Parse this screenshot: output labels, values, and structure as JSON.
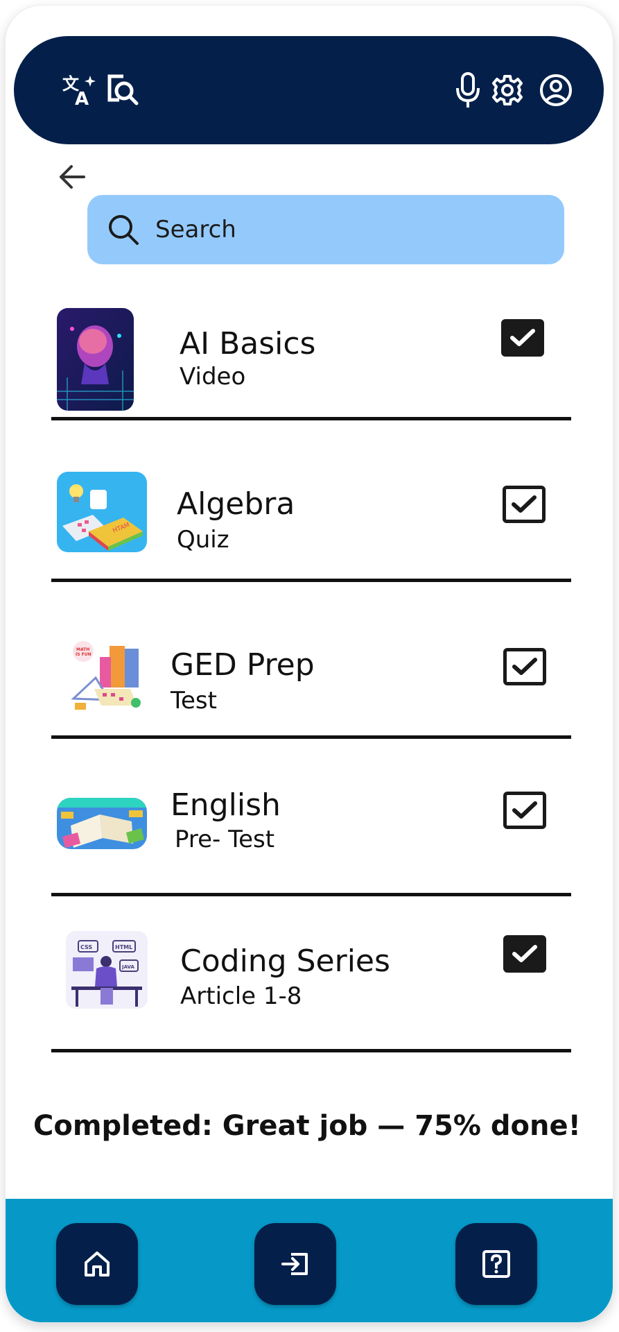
{
  "search": {
    "placeholder": "Search"
  },
  "items": [
    {
      "title": "AI Basics",
      "type": "Video",
      "checked": "filled"
    },
    {
      "title": "Algebra",
      "type": "Quiz",
      "checked": "outline"
    },
    {
      "title": "GED Prep",
      "type": "Test",
      "checked": "outline"
    },
    {
      "title": "English",
      "type": "Pre- Test",
      "checked": "outline"
    },
    {
      "title": "Coding Series",
      "type": "Article 1-8",
      "checked": "filled"
    }
  ],
  "status": {
    "completed_text": "Completed: Great job — 75% done!"
  },
  "thumb_labels": {
    "algebra_book": "HTAM",
    "ged_sign_1": "MATH",
    "ged_sign_2": "IS FUN",
    "coding_css": "CSS",
    "coding_html": "HTML",
    "coding_java": "JAVA"
  },
  "icons": {
    "translate": "translate-icon",
    "search_doc": "document-search-icon",
    "mic": "microphone-icon",
    "settings": "gear-icon",
    "profile": "account-circle-icon",
    "back": "arrow-left-icon",
    "search": "search-icon",
    "home": "home-icon",
    "login": "login-icon",
    "help": "help-icon"
  },
  "colors": {
    "navy": "#04204a",
    "search_bg": "#94cafb",
    "bottom_bar": "#0699c8"
  }
}
